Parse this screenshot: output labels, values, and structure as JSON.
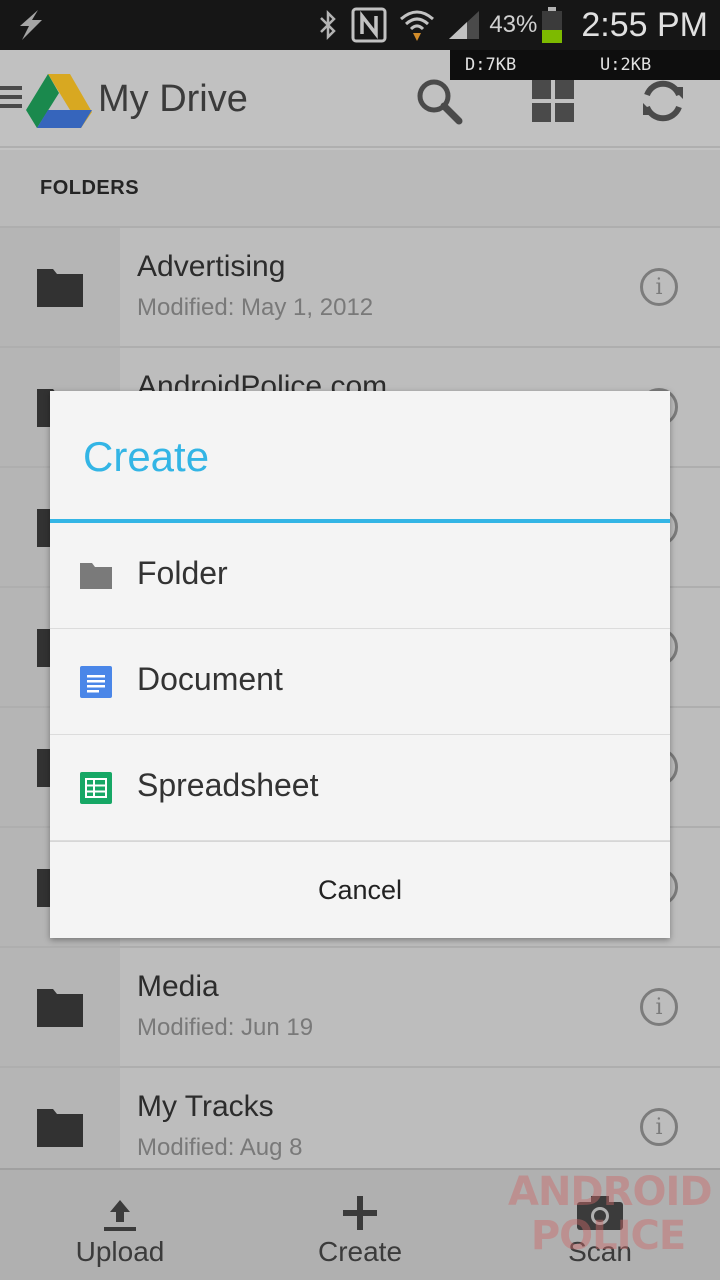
{
  "status_bar": {
    "battery_percent": "43%",
    "clock": "2:55 PM",
    "download_rate": "D:7KB",
    "upload_rate": "U:2KB",
    "icons": [
      "flash-icon",
      "bluetooth-icon",
      "nfc-icon",
      "wifi-icon",
      "signal-icon",
      "battery-icon"
    ]
  },
  "app_bar": {
    "title": "My Drive",
    "actions": [
      "search-icon",
      "grid-view-icon",
      "refresh-icon"
    ]
  },
  "section": {
    "header": "FOLDERS"
  },
  "folders": [
    {
      "name": "Advertising",
      "modified": "Modified: May 1, 2012"
    },
    {
      "name": "AndroidPolice.com",
      "modified": ""
    },
    {
      "name": "",
      "modified": ""
    },
    {
      "name": "",
      "modified": ""
    },
    {
      "name": "",
      "modified": ""
    },
    {
      "name": "",
      "modified": ""
    },
    {
      "name": "Media",
      "modified": "Modified: Jun 19"
    },
    {
      "name": "My Tracks",
      "modified": "Modified: Aug 8"
    }
  ],
  "bottom_bar": {
    "upload_label": "Upload",
    "create_label": "Create",
    "scan_label": "Scan"
  },
  "watermark": {
    "line1": "ANDROID",
    "line2": "POLICE"
  },
  "dialog": {
    "title": "Create",
    "options": [
      {
        "label": "Folder",
        "icon": "folder-icon"
      },
      {
        "label": "Document",
        "icon": "document-icon"
      },
      {
        "label": "Spreadsheet",
        "icon": "spreadsheet-icon"
      }
    ],
    "cancel_label": "Cancel"
  },
  "colors": {
    "accent": "#33b5e5",
    "document_blue": "#4a86e8",
    "spreadsheet_green": "#16a765"
  }
}
